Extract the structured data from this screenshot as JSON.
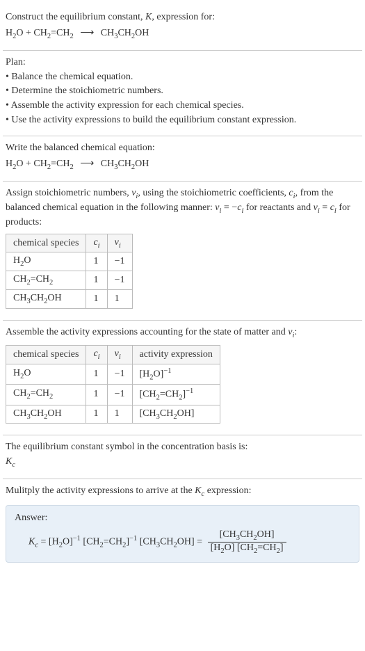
{
  "s1": {
    "intro": "Construct the equilibrium constant, ",
    "K": "K",
    "intro2": ", expression for:",
    "eq_lhs1": "H",
    "eq_lhs1s": "2",
    "eq_lhs1b": "O + CH",
    "eq_lhs1s2": "2",
    "eq_lhs1c": "=CH",
    "eq_lhs1s3": "2",
    "arrow": "⟶",
    "eq_rhs": "CH",
    "eq_rhs_s1": "3",
    "eq_rhs_b": "CH",
    "eq_rhs_s2": "2",
    "eq_rhs_c": "OH"
  },
  "s2": {
    "title": "Plan:",
    "b1": "• Balance the chemical equation.",
    "b2": "• Determine the stoichiometric numbers.",
    "b3": "• Assemble the activity expression for each chemical species.",
    "b4": "• Use the activity expressions to build the equilibrium constant expression."
  },
  "s3": {
    "title": "Write the balanced chemical equation:"
  },
  "s4": {
    "p1a": "Assign stoichiometric numbers, ",
    "nu": "ν",
    "ni": "i",
    "p1b": ", using the stoichiometric coefficients, ",
    "c": "c",
    "p1c": ", from the balanced chemical equation in the following manner: ",
    "eq1": " = −",
    "eq1b": " for reactants and ",
    "eq2": " = ",
    "eq2b": " for products:",
    "th1": "chemical species",
    "th2_c": "c",
    "th2_i": "i",
    "th3_nu": "ν",
    "th3_i": "i",
    "rows": [
      {
        "sp_a": "H",
        "sp_as": "2",
        "sp_b": "O",
        "c": "1",
        "nu": "−1"
      },
      {
        "sp_a": "CH",
        "sp_as": "2",
        "sp_b": "=CH",
        "sp_bs": "2",
        "c": "1",
        "nu": "−1"
      },
      {
        "sp_a": "CH",
        "sp_as": "3",
        "sp_b": "CH",
        "sp_bs": "2",
        "sp_c": "OH",
        "c": "1",
        "nu": "1"
      }
    ]
  },
  "s5": {
    "title_a": "Assemble the activity expressions accounting for the state of matter and ",
    "nu": "ν",
    "ni": "i",
    "title_b": ":",
    "th1": "chemical species",
    "th2_c": "c",
    "th2_i": "i",
    "th3_nu": "ν",
    "th3_i": "i",
    "th4": "activity expression",
    "r1": {
      "sp_a": "H",
      "sp_as": "2",
      "sp_b": "O",
      "c": "1",
      "nu": "−1",
      "ae_a": "[H",
      "ae_as": "2",
      "ae_b": "O]",
      "ae_exp": "−1"
    },
    "r2": {
      "sp_a": "CH",
      "sp_as": "2",
      "sp_b": "=CH",
      "sp_bs": "2",
      "c": "1",
      "nu": "−1",
      "ae_a": "[CH",
      "ae_as": "2",
      "ae_b": "=CH",
      "ae_bs": "2",
      "ae_c": "]",
      "ae_exp": "−1"
    },
    "r3": {
      "sp_a": "CH",
      "sp_as": "3",
      "sp_b": "CH",
      "sp_bs": "2",
      "sp_c": "OH",
      "c": "1",
      "nu": "1",
      "ae_a": "[CH",
      "ae_as": "3",
      "ae_b": "CH",
      "ae_bs": "2",
      "ae_c": "OH]"
    }
  },
  "s6": {
    "title": "The equilibrium constant symbol in the concentration basis is:",
    "K": "K",
    "Kc": "c"
  },
  "s7": {
    "title_a": "Mulitply the activity expressions to arrive at the ",
    "K": "K",
    "Kc": "c",
    "title_b": " expression:",
    "answer": "Answer:",
    "eq_K": "K",
    "eq_Kc": "c",
    "eq_eq": " = ",
    "t1_a": "[H",
    "t1_as": "2",
    "t1_b": "O]",
    "t1_exp": "−1",
    "t2_a": " [CH",
    "t2_as": "2",
    "t2_b": "=CH",
    "t2_bs": "2",
    "t2_c": "]",
    "t2_exp": "−1",
    "t3_a": " [CH",
    "t3_as": "3",
    "t3_b": "CH",
    "t3_bs": "2",
    "t3_c": "OH] = ",
    "frac_num_a": "[CH",
    "frac_num_as": "3",
    "frac_num_b": "CH",
    "frac_num_bs": "2",
    "frac_num_c": "OH]",
    "frac_den_a": "[H",
    "frac_den_as": "2",
    "frac_den_b": "O] [CH",
    "frac_den_bs": "2",
    "frac_den_c": "=CH",
    "frac_den_cs": "2",
    "frac_den_d": "]"
  }
}
